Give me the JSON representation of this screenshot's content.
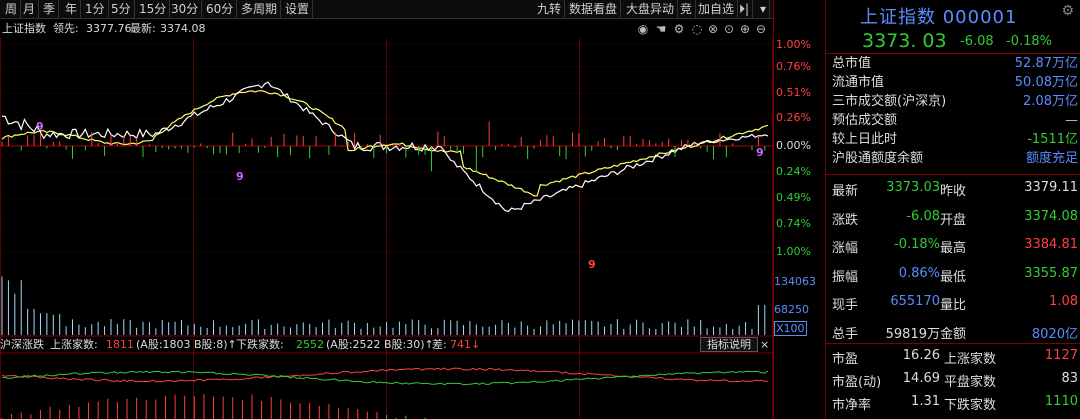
{
  "toolbar": {
    "left_tabs": [
      "周",
      "月",
      "季",
      "年",
      "1分",
      "5分",
      "15分",
      "30分",
      "60分",
      "多周期",
      "设置"
    ],
    "right_tabs": [
      "九转",
      "数据看盘",
      "大盘异动",
      "竞",
      "加自选"
    ]
  },
  "info": {
    "name": "上证指数",
    "lead_label": "领先:",
    "lead_value": "3377.76",
    "last_label": "最新:",
    "last_value": "3374.08"
  },
  "pct_axis": [
    "1.00%",
    "0.76%",
    "0.51%",
    "0.26%",
    "0.00%",
    "0.24%",
    "0.49%",
    "0.74%",
    "1.00%"
  ],
  "volume_axis": [
    "134063",
    "68250",
    "X100"
  ],
  "breadth": {
    "name": "沪深涨跌",
    "up_label": "上涨家数:",
    "up_value": "1811",
    "up_detail": "(A股:1803 B股:8)↑",
    "down_label": "下跌家数:",
    "down_value": "2552",
    "down_detail": "(A股:2522 B股:30)↑",
    "diff_label": "差:",
    "diff_value": "741↓",
    "help": "指标说明"
  },
  "quote": {
    "title": "上证指数 000001",
    "price": "3373. 03",
    "change": "-6.08",
    "change_pct": "-0.18%"
  },
  "stats": [
    {
      "label": "总市值",
      "value": "52.87万亿",
      "color": "#5a8cff"
    },
    {
      "label": "流通市值",
      "value": "50.08万亿",
      "color": "#5a8cff"
    },
    {
      "label": "三市成交额(沪深京)",
      "value": "2.08万亿",
      "color": "#5a8cff"
    },
    {
      "label": "预估成交额",
      "value": "—",
      "color": "#bbbbbb"
    },
    {
      "label": "较上日此时",
      "value": "-1511亿",
      "color": "#33cc33"
    },
    {
      "label": "沪股通额度余额",
      "value": "额度充足",
      "color": "#5a8cff"
    }
  ],
  "grid": [
    {
      "l1": "最新",
      "v1": "3373.03",
      "c1": "#33cc33",
      "l2": "昨收",
      "v2": "3379.11",
      "c2": "#dddddd"
    },
    {
      "l1": "涨跌",
      "v1": "-6.08",
      "c1": "#33cc33",
      "l2": "开盘",
      "v2": "3374.08",
      "c2": "#33cc33"
    },
    {
      "l1": "涨幅",
      "v1": "-0.18%",
      "c1": "#33cc33",
      "l2": "最高",
      "v2": "3384.81",
      "c2": "#ff4040"
    },
    {
      "l1": "振幅",
      "v1": "0.86%",
      "c1": "#5a8cff",
      "l2": "最低",
      "v2": "3355.87",
      "c2": "#33cc33"
    },
    {
      "l1": "现手",
      "v1": "655170",
      "c1": "#5a8cff",
      "l2": "量比",
      "v2": "1.08",
      "c2": "#ff4040"
    },
    {
      "l1": "总手",
      "v1": "59819万",
      "c1": "#dddddd",
      "l2": "金额",
      "v2": "8020亿",
      "c2": "#5a8cff"
    }
  ],
  "bottom": [
    {
      "l1": "市盈",
      "v1": "16.26",
      "l2": "上涨家数",
      "v2": "1127",
      "c2": "#ff4040"
    },
    {
      "l1": "市盈(动)",
      "v1": "14.69",
      "l2": "平盘家数",
      "v2": "83",
      "c2": "#dddddd"
    },
    {
      "l1": "市净率",
      "v1": "1.31",
      "l2": "下跌家数",
      "v2": "1110",
      "c2": "#33cc33"
    }
  ],
  "nine_marks": [
    "9",
    "9",
    "9",
    "9"
  ],
  "colors": {
    "up": "#ff4040",
    "down": "#33cc33",
    "price_line": "#ffffff",
    "avg_line": "#ffff66",
    "axis_red": "#cc2222",
    "blue": "#5a8cff"
  }
}
